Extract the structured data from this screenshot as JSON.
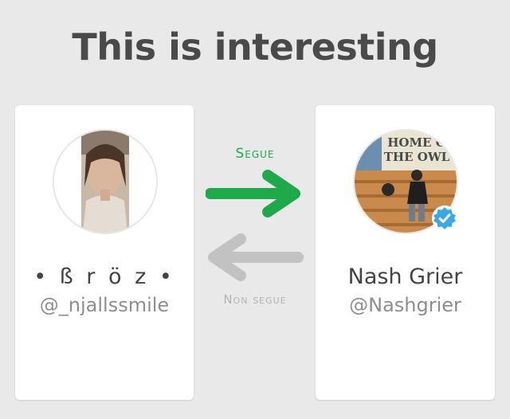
{
  "title": "This is interesting",
  "left_user": {
    "name": "• ß r ö z •",
    "handle": "@_njallssmile"
  },
  "right_user": {
    "name": "Nash Grier",
    "handle": "@Nashgrier",
    "avatar_text_line1": "HOME O",
    "avatar_text_line2": "THE OWL"
  },
  "relationship": {
    "follows_label": "Segue",
    "not_follows_label": "Non segue"
  },
  "colors": {
    "background": "#e9e9e9",
    "follow_arrow": "#1ea94b",
    "not_follow_arrow": "#c2c2c2",
    "verified_badge": "#3aa7e8",
    "title_text": "#4a4a4a"
  }
}
